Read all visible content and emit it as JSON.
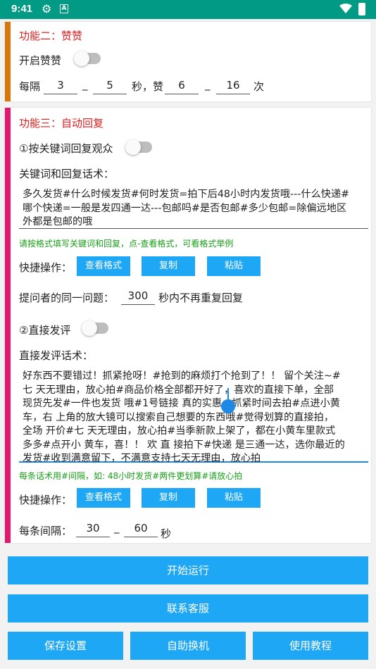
{
  "status_bar": {
    "time": "9:41"
  },
  "section2": {
    "title": "功能二：赞赞",
    "toggle_label": "开启赞赞",
    "every_label": "每隔",
    "interval_from": "3",
    "interval_to": "5",
    "seconds_like_label": "秒，赞",
    "likes_from": "6",
    "likes_to": "16",
    "times_label": "次",
    "dash": "_"
  },
  "section3": {
    "title": "功能三：自动回复",
    "keyword_toggle_label": "①按关键词回复观众",
    "keyword_label": "关键词和回复话术：",
    "keyword_text_lines": [
      "多久发货#什么时候发货#何时发货=拍下后48小时内发货哦---什么快递#",
      "哪个快递=一般是发四通一达---包邮吗#是否包邮#多少包邮=除偏远地区",
      "外都是包邮的哦"
    ],
    "keyword_hint": "请按格式填写关键词和回复，点-查看格式，可看格式举例",
    "quick_ops_label": "快捷操作：",
    "btn_view_format": "查看格式",
    "btn_copy": "复制",
    "btn_paste": "粘贴",
    "same_question_label": "提问者的同一问题：",
    "same_question_seconds": "300",
    "same_question_suffix": "秒内不再重复回复",
    "direct_toggle_label": "②直接发评",
    "direct_label": "直接发评话术：",
    "direct_text_lines": [
      "好东西不要错过！抓紧抢呀！#抢到的麻烦打个抢到了！！ 留个关注~#",
      "七 天无理由，放心拍#商品价格全部都开好了，喜欢的直接下单，全部",
      "现货先发#一件也发货 哦#1号链接 真的实惠，抓紧时间去拍#点进小黄",
      "车，右 上角的放大镜可以搜索自己想要的东西哦#觉得划算的直接拍，",
      "全场 开价#七 天无理由，放心拍#当季新款上架了，都在小黄车里款式",
      "多多#点开小 黄车，喜！！ 欢 直 接拍下#快递 是三通一达，选你最近的",
      "发货#收到满意留下，不满意支持七天无理由，放心拍"
    ],
    "direct_hint": "每条话术用#间隔，如: 48小时发货#两件更划算#请放心拍",
    "interval_label": "每条间隔：",
    "interval_from": "30",
    "interval_to": "60",
    "interval_unit": "秒"
  },
  "actions": {
    "start": "开始运行",
    "contact": "联系客服",
    "save": "保存设置",
    "switch": "自助换机",
    "tutorial": "使用教程"
  },
  "colors": {
    "status_bar": "#009a85",
    "section2_bar": "#d9760a",
    "section3_bar": "#e4176f",
    "button": "#1ea7f5",
    "title_red": "#e02020",
    "hint_green": "#1aa01a"
  }
}
